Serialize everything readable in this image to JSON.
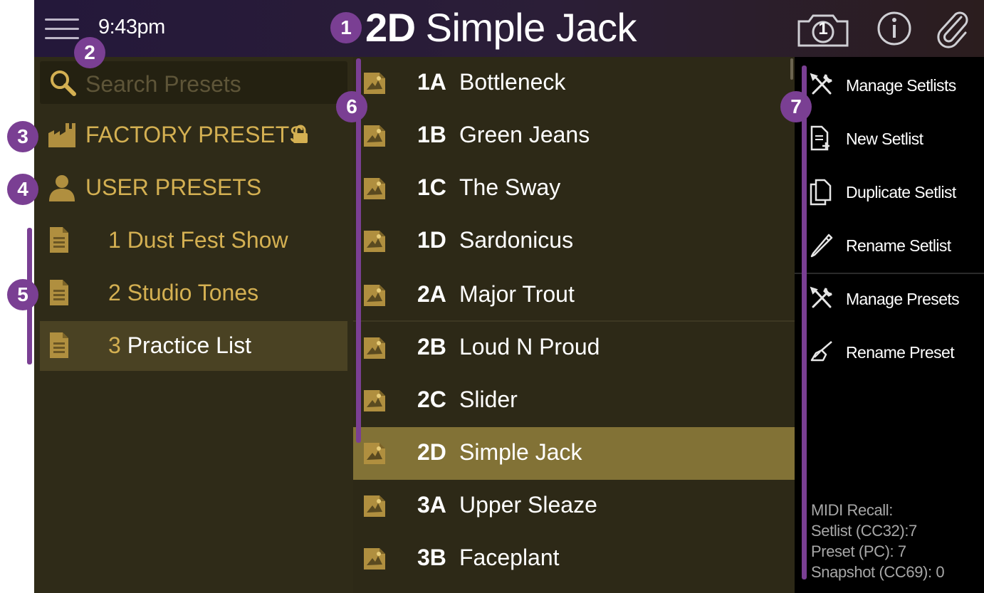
{
  "header": {
    "time": "9:43pm",
    "preset_id": "2D",
    "preset_name": "Simple Jack",
    "snapshot_number": "1"
  },
  "sidebar": {
    "search_placeholder": "Search Presets",
    "factory_label": "FACTORY PRESETS",
    "user_label": "USER PRESETS",
    "setlists": [
      {
        "num": "1",
        "name": "Dust Fest Show"
      },
      {
        "num": "2",
        "name": "Studio Tones"
      },
      {
        "num": "3",
        "name": "Practice List"
      }
    ]
  },
  "presets": [
    {
      "id": "1A",
      "name": "Bottleneck"
    },
    {
      "id": "1B",
      "name": "Green Jeans"
    },
    {
      "id": "1C",
      "name": "The Sway"
    },
    {
      "id": "1D",
      "name": "Sardonicus"
    },
    {
      "id": "2A",
      "name": "Major Trout"
    },
    {
      "id": "2B",
      "name": "Loud N Proud"
    },
    {
      "id": "2C",
      "name": "Slider"
    },
    {
      "id": "2D",
      "name": "Simple Jack"
    },
    {
      "id": "3A",
      "name": "Upper Sleaze"
    },
    {
      "id": "3B",
      "name": "Faceplant"
    }
  ],
  "menu": {
    "manage_setlists": "Manage Setlists",
    "new_setlist": "New Setlist",
    "duplicate_setlist": "Duplicate Setlist",
    "rename_setlist": "Rename Setlist",
    "manage_presets": "Manage Presets",
    "rename_preset": "Rename Preset"
  },
  "midi": {
    "heading": "MIDI Recall:",
    "setlist": "Setlist (CC32):7",
    "preset": "Preset (PC): 7",
    "snapshot": "Snapshot (CC69): 0"
  },
  "callouts": [
    "1",
    "2",
    "3",
    "4",
    "5",
    "6",
    "7"
  ],
  "colors": {
    "accent_gold": "#d4b052",
    "callout_purple": "#7a3f93",
    "selected_preset": "#827236"
  },
  "selection": {
    "selected_preset": "2D",
    "selected_setlist": "3"
  }
}
